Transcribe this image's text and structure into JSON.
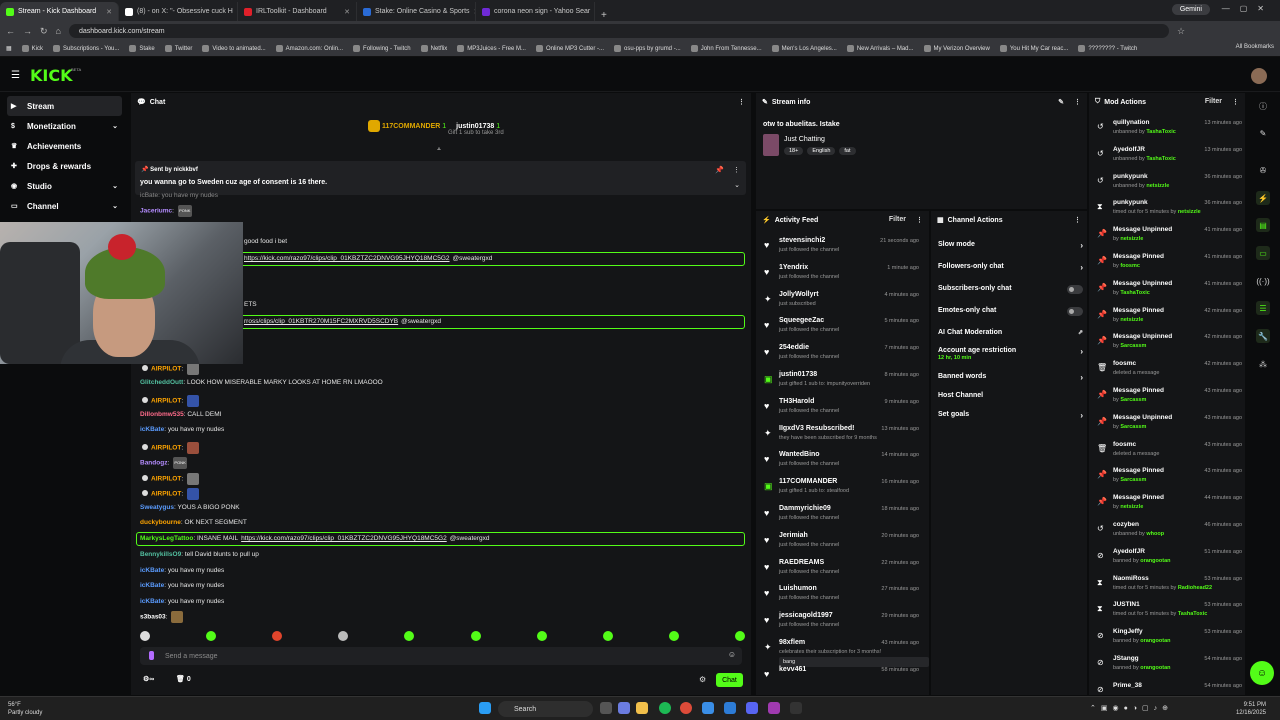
{
  "browser": {
    "tabs": [
      {
        "title": "Stream - Kick Dashboard",
        "color": "#53fc18",
        "active": true
      },
      {
        "title": "(8) - on X: \"- Obsessive cuck H",
        "color": "#ffffff"
      },
      {
        "title": "IRLToolkit - Dashboard",
        "color": "#e0202a"
      },
      {
        "title": "Stake: Online Casino & Sports",
        "color": "#2a6bd6"
      },
      {
        "title": "corona neon sign - Yahoo Sear",
        "color": "#6f2ad6"
      }
    ],
    "gemini_label": "Gemini",
    "url": "dashboard.kick.com/stream",
    "bookmarks": [
      "Kick",
      "Subscriptions - You...",
      "Stake",
      "Twitter",
      "Video to animated...",
      "Amazon.com: Onlin...",
      "Following - Twitch",
      "Netflix",
      "MP3Juices - Free M...",
      "Online MP3 Cutter -...",
      "osu-pps by grumd -...",
      "John From Tennesse...",
      "Men's Los Angeles...",
      "New Arrivals – Mad...",
      "My Verizon Overview",
      "You Hit My Car reac...",
      "???????? - Twitch"
    ],
    "all_bookmarks": "All Bookmarks"
  },
  "kick": {
    "logo": "KICK",
    "beta": "BETA"
  },
  "nav": {
    "items": [
      {
        "label": "Stream",
        "icon": "stream-icon",
        "active": true,
        "chev": false
      },
      {
        "label": "Monetization",
        "icon": "dollar-icon",
        "chev": true
      },
      {
        "label": "Achievements",
        "icon": "trophy-icon",
        "chev": false
      },
      {
        "label": "Drops & rewards",
        "icon": "gift-icon",
        "chev": false
      },
      {
        "label": "Studio",
        "icon": "camera-icon",
        "chev": true
      },
      {
        "label": "Channel",
        "icon": "tv-icon",
        "chev": true
      }
    ]
  },
  "chat": {
    "title": "Chat",
    "gift": {
      "top1": "117COMMANDER",
      "top1_count": "1",
      "top2": "justin01738",
      "top2_count": "1",
      "cta": "Gift 1 sub to take 3rd"
    },
    "pinned": {
      "sent_by_label": "Sent by",
      "sender": "nickkbvf",
      "text": "you wanna go to Sweden cuz age of consent is 16 there."
    },
    "partial_top": "icBate: you have my nudes",
    "partial": [
      {
        "text": "good food i bet"
      },
      {
        "text": "ETS"
      }
    ],
    "messages": [
      {
        "nick": "Jaceriumc",
        "color": "#b48cff",
        "text": "",
        "emoji": "PONK"
      },
      {
        "nick": "AIRPILOT",
        "color": "#ffa500",
        "text": "",
        "emoji": "a"
      },
      {
        "nick": "GlitcheddOutt",
        "color": "#53c0a0",
        "text": "LOOK HOW MISERABLE MARKY LOOKS AT HOME RN LMAOOO"
      },
      {
        "nick": "AIRPILOT",
        "color": "#ffa500",
        "text": "",
        "emoji": "b"
      },
      {
        "nick": "Dillonbmw535",
        "color": "#ff6b8a",
        "text": "CALL DEMI"
      },
      {
        "nick": "icKBate",
        "color": "#5b9cff",
        "text": "you have my nudes"
      },
      {
        "nick": "AIRPILOT",
        "color": "#ffa500",
        "text": "",
        "emoji": "c"
      },
      {
        "nick": "Bandogz",
        "color": "#b48cff",
        "text": "",
        "emoji": "PONK"
      },
      {
        "nick": "AIRPILOT",
        "color": "#ffa500",
        "text": "",
        "emoji": "d"
      },
      {
        "nick": "AIRPILOT",
        "color": "#ffa500",
        "text": "",
        "emoji": "e"
      },
      {
        "nick": "Sweatygus",
        "color": "#5b9cff",
        "text": "YOUS A BIGO PONK"
      },
      {
        "nick": "duckybourne",
        "color": "#ffa500",
        "text": "OK NEXT SEGMENT"
      },
      {
        "nick": "MarkysLegTattoo",
        "color": "#53fc18",
        "text": "INSANE MAIL",
        "link": "https://kick.com/razo97/clips/clip_01KBZTZC2DNVG95JHYQ18MC5G2",
        "mention": "@sweatergxd",
        "highlight": true
      },
      {
        "nick": "BennykillsO9",
        "color": "#53c0a0",
        "text": "tell David blunts to pull up"
      },
      {
        "nick": "icKBate",
        "color": "#5b9cff",
        "text": "you have my nudes"
      },
      {
        "nick": "icKBate",
        "color": "#5b9cff",
        "text": "you have my nudes"
      },
      {
        "nick": "icKBate",
        "color": "#5b9cff",
        "text": "you have my nudes"
      },
      {
        "nick": "s3bas03",
        "color": "#ffffff",
        "text": "",
        "emoji": "f"
      }
    ],
    "links": [
      {
        "url": "https://kick.com/razo97/clips/clip_01KBZTZC2DNVG95JHYQ18MC5G2",
        "mention": "@sweatergxd"
      },
      {
        "url": "rross/clips/clip_01KBTR270M15FC2MXRVD5SCDYB",
        "mention": "@sweatergxd"
      }
    ],
    "input_placeholder": "Send a message",
    "send_label": "Chat",
    "viewers": "0",
    "gift_count": "0"
  },
  "stream_info": {
    "title": "Stream info",
    "stream_title": "otw to abuelitas. Istake",
    "category": "Just Chatting",
    "tags": [
      "18+",
      "English",
      "fat"
    ]
  },
  "activity": {
    "title": "Activity Feed",
    "filter_label": "Filter",
    "items": [
      {
        "user": "stevensinchi2",
        "sub": "just followed the channel",
        "time": "21 seconds ago",
        "icon": "heart-icon"
      },
      {
        "user": "1Yendrix",
        "sub": "just followed the channel",
        "time": "1 minute ago",
        "icon": "heart-icon"
      },
      {
        "user": "JollyWollyrt",
        "sub": "just subscribed",
        "time": "4 minutes ago",
        "icon": "star-icon"
      },
      {
        "user": "SqueegeeZac",
        "sub": "just followed the channel",
        "time": "5 minutes ago",
        "icon": "heart-icon"
      },
      {
        "user": "254eddie",
        "sub": "just followed the channel",
        "time": "7 minutes ago",
        "icon": "heart-icon"
      },
      {
        "user": "justin01738",
        "sub": "just gifted 1 sub to: impunityoverriden",
        "time": "8 minutes ago",
        "icon": "gift-icon"
      },
      {
        "user": "TH3Harold",
        "sub": "just followed the channel",
        "time": "9 minutes ago",
        "icon": "heart-icon"
      },
      {
        "user": "IIgxdV3 Resubscribed!",
        "sub": "they have been subscribed for 9 months",
        "time": "13 minutes ago",
        "icon": "star-icon"
      },
      {
        "user": "WantedBino",
        "sub": "just followed the channel",
        "time": "14 minutes ago",
        "icon": "heart-icon"
      },
      {
        "user": "117COMMANDER",
        "sub": "just gifted 1 sub to: stealfood",
        "time": "16 minutes ago",
        "icon": "gift-icon"
      },
      {
        "user": "Dammyrichie09",
        "sub": "just followed the channel",
        "time": "18 minutes ago",
        "icon": "heart-icon"
      },
      {
        "user": "Jerimiah",
        "sub": "just followed the channel",
        "time": "20 minutes ago",
        "icon": "heart-icon"
      },
      {
        "user": "RAEDREAMS",
        "sub": "just followed the channel",
        "time": "22 minutes ago",
        "icon": "heart-icon"
      },
      {
        "user": "Luishumon",
        "sub": "just followed the channel",
        "time": "27 minutes ago",
        "icon": "heart-icon"
      },
      {
        "user": "jessicagold1997",
        "sub": "just followed the channel",
        "time": "29 minutes ago",
        "icon": "heart-icon"
      },
      {
        "user": "98xflem",
        "sub": "celebrates their subscription for 3 months!",
        "time": "43 minutes ago",
        "icon": "star-icon",
        "note": "bang"
      },
      {
        "user": "kevv461",
        "sub": "",
        "time": "58 minutes ago",
        "icon": "heart-icon"
      }
    ]
  },
  "channel_actions": {
    "title": "Channel Actions",
    "items": [
      {
        "label": "Slow mode",
        "kind": "arrow"
      },
      {
        "label": "Followers-only chat",
        "kind": "arrow"
      },
      {
        "label": "Subscribers-only chat",
        "kind": "toggle"
      },
      {
        "label": "Emotes-only chat",
        "kind": "toggle"
      },
      {
        "label": "AI Chat Moderation",
        "kind": "ext"
      },
      {
        "label": "Account age restriction",
        "kind": "arrow",
        "sub": "12 hr, 10 min"
      },
      {
        "label": "Banned words",
        "kind": "arrow"
      },
      {
        "label": "Host Channel",
        "kind": "none"
      },
      {
        "label": "Set goals",
        "kind": "arrow"
      }
    ]
  },
  "mod_actions": {
    "title": "Mod Actions",
    "filter_label": "Filter",
    "items": [
      {
        "user": "quillynation",
        "action": "unbanned by",
        "by": "TashaToxic",
        "time": "13 minutes ago",
        "icon": "undo-icon"
      },
      {
        "user": "AyedolfJR",
        "action": "unbanned by",
        "by": "TashaToxic",
        "time": "13 minutes ago",
        "icon": "undo-icon"
      },
      {
        "user": "punkypunk",
        "action": "unbanned by",
        "by": "netsizzle",
        "time": "36 minutes ago",
        "icon": "undo-icon"
      },
      {
        "user": "punkypunk",
        "action": "timed out for 5 minutes by",
        "by": "netsizzle",
        "time": "36 minutes ago",
        "icon": "hourglass-icon"
      },
      {
        "user": "Message Unpinned",
        "action": "by",
        "by": "netsizzle",
        "time": "41 minutes ago",
        "icon": "pin-icon"
      },
      {
        "user": "Message Pinned",
        "action": "by",
        "by": "foosmc",
        "time": "41 minutes ago",
        "icon": "pin-icon"
      },
      {
        "user": "Message Unpinned",
        "action": "by",
        "by": "TashaToxic",
        "time": "41 minutes ago",
        "icon": "pin-icon"
      },
      {
        "user": "Message Pinned",
        "action": "by",
        "by": "netsizzle",
        "time": "42 minutes ago",
        "icon": "pin-icon"
      },
      {
        "user": "Message Unpinned",
        "action": "by",
        "by": "Sarcassm",
        "time": "42 minutes ago",
        "icon": "pin-icon"
      },
      {
        "user": "foosmc",
        "action": "deleted a message",
        "by": "",
        "time": "42 minutes ago",
        "icon": "trash-icon"
      },
      {
        "user": "Message Pinned",
        "action": "by",
        "by": "Sarcassm",
        "time": "43 minutes ago",
        "icon": "pin-icon"
      },
      {
        "user": "Message Unpinned",
        "action": "by",
        "by": "Sarcassm",
        "time": "43 minutes ago",
        "icon": "pin-icon"
      },
      {
        "user": "foosmc",
        "action": "deleted a message",
        "by": "",
        "time": "43 minutes ago",
        "icon": "trash-icon"
      },
      {
        "user": "Message Pinned",
        "action": "by",
        "by": "Sarcassm",
        "time": "43 minutes ago",
        "icon": "pin-icon"
      },
      {
        "user": "Message Pinned",
        "action": "by",
        "by": "netsizzle",
        "time": "44 minutes ago",
        "icon": "pin-icon"
      },
      {
        "user": "cozyben",
        "action": "unbanned by",
        "by": "whoop",
        "time": "46 minutes ago",
        "icon": "undo-icon"
      },
      {
        "user": "AyedolfJR",
        "action": "banned by",
        "by": "orangootan",
        "time": "51 minutes ago",
        "icon": "ban-icon"
      },
      {
        "user": "NaomiRoss",
        "action": "timed out for 5 minutes by",
        "by": "Radiohead22",
        "time": "53 minutes ago",
        "icon": "hourglass-icon"
      },
      {
        "user": "JUSTIN1",
        "action": "timed out for 5 minutes by",
        "by": "TashaToxic",
        "time": "53 minutes ago",
        "icon": "hourglass-icon"
      },
      {
        "user": "KingJeffy",
        "action": "banned by",
        "by": "orangootan",
        "time": "53 minutes ago",
        "icon": "ban-icon"
      },
      {
        "user": "JStangg",
        "action": "banned by",
        "by": "orangootan",
        "time": "54 minutes ago",
        "icon": "ban-icon"
      },
      {
        "user": "Prime_38",
        "action": "",
        "by": "",
        "time": "54 minutes ago",
        "icon": "ban-icon"
      }
    ]
  },
  "taskbar": {
    "temp": "56°F",
    "weather": "Partly cloudy",
    "search": "Search",
    "time": "9:51 PM",
    "date": "12/16/2025"
  },
  "colors": {
    "accent": "#53fc18",
    "bg": "#0b0c0d",
    "panel": "#141517"
  }
}
